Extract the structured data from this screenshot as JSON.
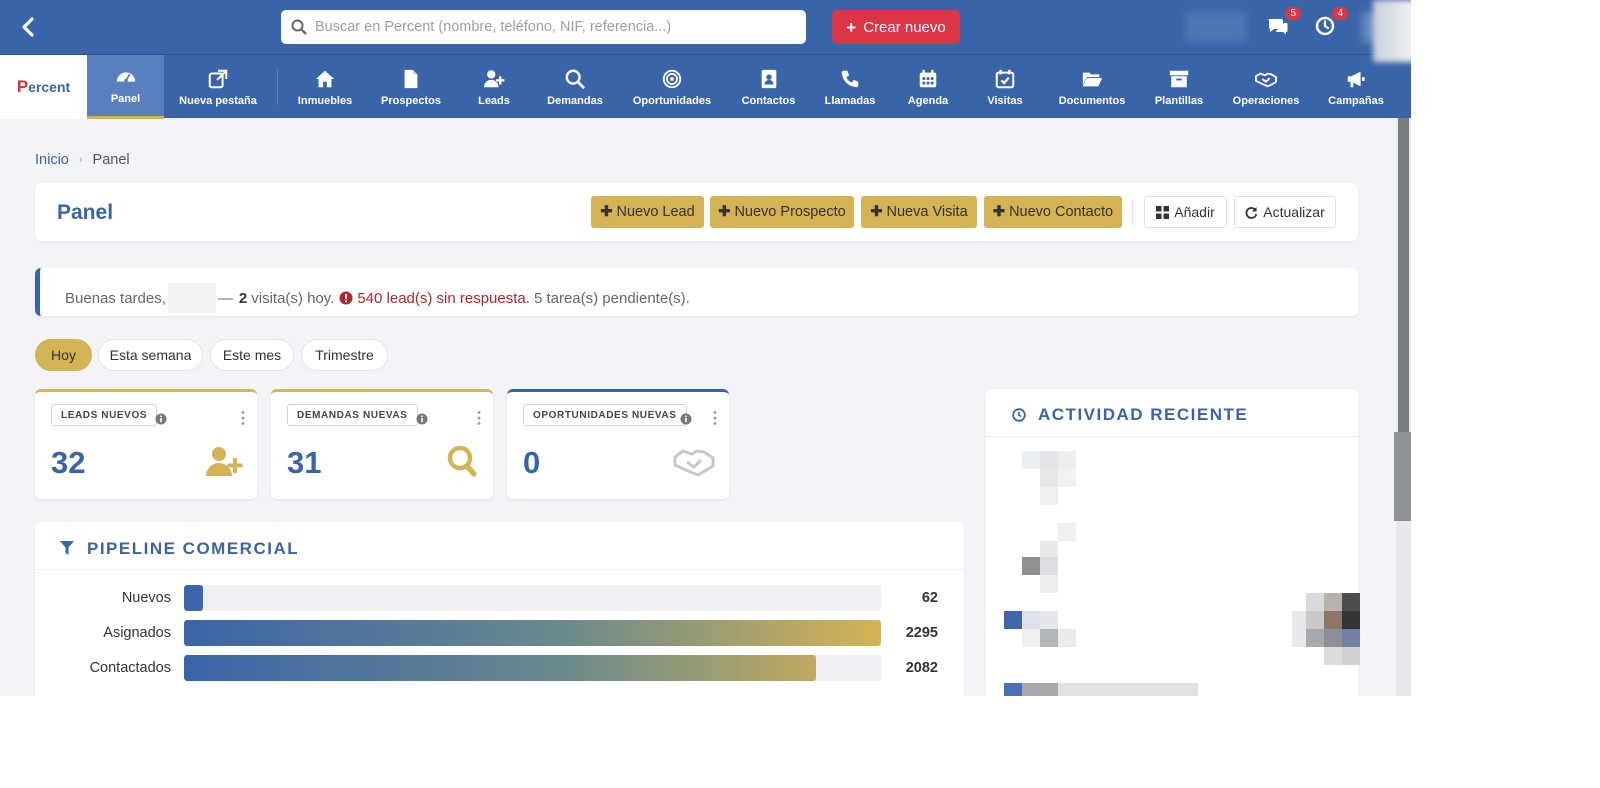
{
  "search": {
    "placeholder": "Buscar en Percent (nombre, teléfono, NIF, referencia...)"
  },
  "topbar": {
    "create_label": "Crear nuevo",
    "messages_badge": "5",
    "notifications_badge": "4"
  },
  "logo": {
    "initial": "P",
    "rest": "ercent"
  },
  "nav": {
    "items": [
      {
        "label": "Panel",
        "icon": "gauge-icon"
      },
      {
        "label": "Nueva pestaña",
        "icon": "external-link-icon"
      },
      {
        "label": "Inmuebles",
        "icon": "home-icon"
      },
      {
        "label": "Prospectos",
        "icon": "document-icon"
      },
      {
        "label": "Leads",
        "icon": "user-plus-icon"
      },
      {
        "label": "Demandas",
        "icon": "search-icon"
      },
      {
        "label": "Oportunidades",
        "icon": "target-icon"
      },
      {
        "label": "Contactos",
        "icon": "address-book-icon"
      },
      {
        "label": "Llamadas",
        "icon": "phone-icon"
      },
      {
        "label": "Agenda",
        "icon": "calendar-icon"
      },
      {
        "label": "Visitas",
        "icon": "calendar-check-icon"
      },
      {
        "label": "Documentos",
        "icon": "folder-open-icon"
      },
      {
        "label": "Plantillas",
        "icon": "archive-icon"
      },
      {
        "label": "Operaciones",
        "icon": "handshake-icon"
      },
      {
        "label": "Campañas",
        "icon": "megaphone-icon"
      }
    ],
    "active_index": 0
  },
  "breadcrumb": {
    "home": "Inicio",
    "current": "Panel"
  },
  "header": {
    "title": "Panel",
    "buttons": {
      "nuevo_lead": "Nuevo Lead",
      "nuevo_prospecto": "Nuevo Prospecto",
      "nueva_visita": "Nueva Visita",
      "nuevo_contacto": "Nuevo Contacto",
      "anadir": "Añadir",
      "actualizar": "Actualizar"
    }
  },
  "greeting": {
    "salutation": "Buenas tardes,",
    "dash": "—",
    "visits_count": "2",
    "visits_text": "visita(s) hoy.",
    "leads_alert": "540 lead(s) sin respuesta.",
    "tasks_text": "5 tarea(s) pendiente(s)."
  },
  "periods": {
    "items": [
      "Hoy",
      "Esta semana",
      "Este mes",
      "Trimestre"
    ],
    "active_index": 0
  },
  "stats": [
    {
      "label": "LEADS NUEVOS",
      "value": "32",
      "icon": "user-plus-icon",
      "accent": "#d4b355"
    },
    {
      "label": "DEMANDAS NUEVAS",
      "value": "31",
      "icon": "search-icon",
      "accent": "#d4b355"
    },
    {
      "label": "OPORTUNIDADES NUEVAS",
      "value": "0",
      "icon": "handshake-icon",
      "accent": "#3a64a8"
    }
  ],
  "pipeline": {
    "title": "PIPELINE COMERCIAL",
    "max": 2295,
    "stages": [
      {
        "label": "Nuevos",
        "value": 62,
        "display": "62"
      },
      {
        "label": "Asignados",
        "value": 2295,
        "display": "2295"
      },
      {
        "label": "Contactados",
        "value": 2082,
        "display": "2082"
      }
    ]
  },
  "activity": {
    "title": "ACTIVIDAD RECIENTE"
  },
  "colors": {
    "primary": "#3a64a8",
    "gold": "#d4b355",
    "danger": "#dc3545"
  }
}
